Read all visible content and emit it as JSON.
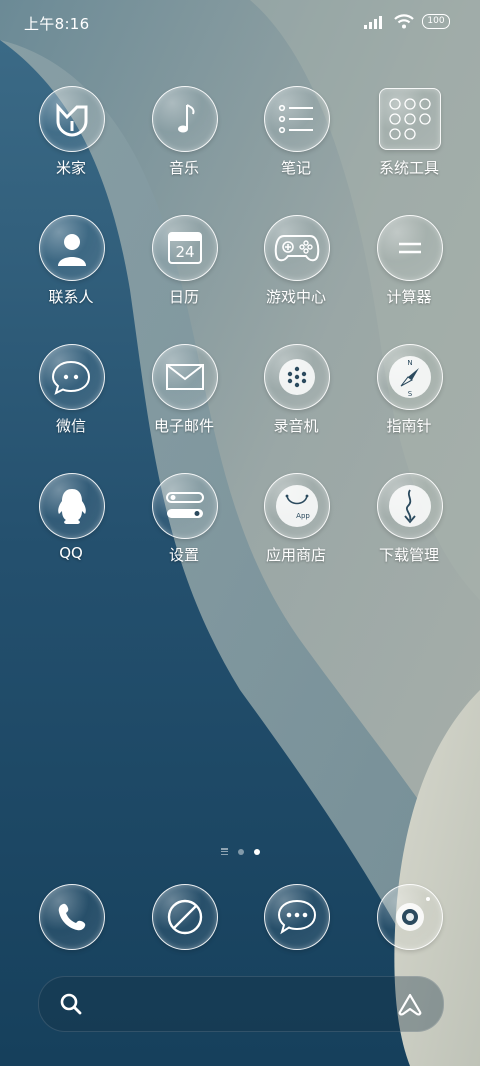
{
  "status_bar": {
    "time": "上午8:16",
    "battery": "100"
  },
  "apps": [
    {
      "label": "米家",
      "icon": "mijia-icon"
    },
    {
      "label": "音乐",
      "icon": "music-note-icon"
    },
    {
      "label": "笔记",
      "icon": "notes-list-icon"
    },
    {
      "label": "系统工具",
      "icon": "system-tools-folder-icon"
    },
    {
      "label": "联系人",
      "icon": "contact-person-icon"
    },
    {
      "label": "日历",
      "icon": "calendar-icon",
      "badge": "24"
    },
    {
      "label": "游戏中心",
      "icon": "gamepad-icon"
    },
    {
      "label": "计算器",
      "icon": "calculator-equals-icon"
    },
    {
      "label": "微信",
      "icon": "wechat-icon"
    },
    {
      "label": "电子邮件",
      "icon": "mail-icon"
    },
    {
      "label": "录音机",
      "icon": "recorder-icon"
    },
    {
      "label": "指南针",
      "icon": "compass-icon",
      "n": "N",
      "s": "S"
    },
    {
      "label": "QQ",
      "icon": "qq-penguin-icon"
    },
    {
      "label": "设置",
      "icon": "settings-toggle-icon"
    },
    {
      "label": "应用商店",
      "icon": "app-store-bag-icon",
      "text": "App"
    },
    {
      "label": "下载管理",
      "icon": "download-manager-icon"
    }
  ],
  "dock": [
    {
      "icon": "phone-icon"
    },
    {
      "icon": "browser-icon"
    },
    {
      "icon": "messages-icon"
    },
    {
      "icon": "camera-icon"
    }
  ],
  "page_indicator": {
    "pages": 3,
    "active": 3
  },
  "colors": {
    "wallpaper_dark": "#1d4a68",
    "wallpaper_light": "#c9cdc2",
    "glass_border": "#ffffff"
  }
}
